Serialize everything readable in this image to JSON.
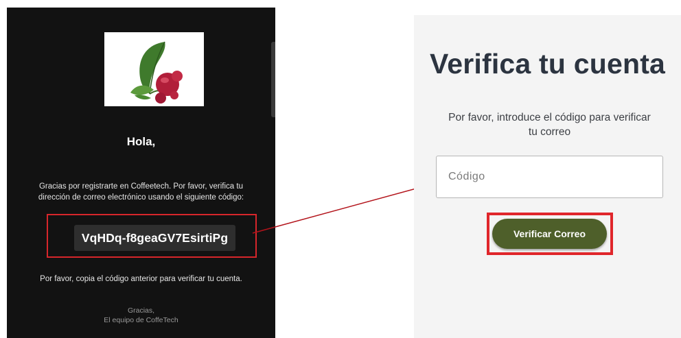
{
  "email": {
    "greeting": "Hola,",
    "body_line1": "Gracias por registrarte en Coffeetech. Por favor, verifica tu",
    "body_line2": "dirección de correo electrónico usando el siguiente código:",
    "code": "VqHDq-f8geaGV7EsirtiPg",
    "copy_instruction": "Por favor, copia el código anterior para verificar tu cuenta.",
    "signoff": "Gracias,",
    "team": "El equipo de CoffeTech",
    "logo_icon": "coffee-leaf-logo",
    "background_color": "#121212"
  },
  "verify": {
    "title": "Verifica tu cuenta",
    "subtitle_line1": "Por favor, introduce el código para verificar",
    "subtitle_line2": "tu correo",
    "input_placeholder": "Código",
    "input_value": "",
    "button_label": "Verificar Correo",
    "button_color": "#4e5f2a"
  },
  "annotation": {
    "highlight_color": "#d7262b",
    "arrow_color": "#b3141b"
  }
}
